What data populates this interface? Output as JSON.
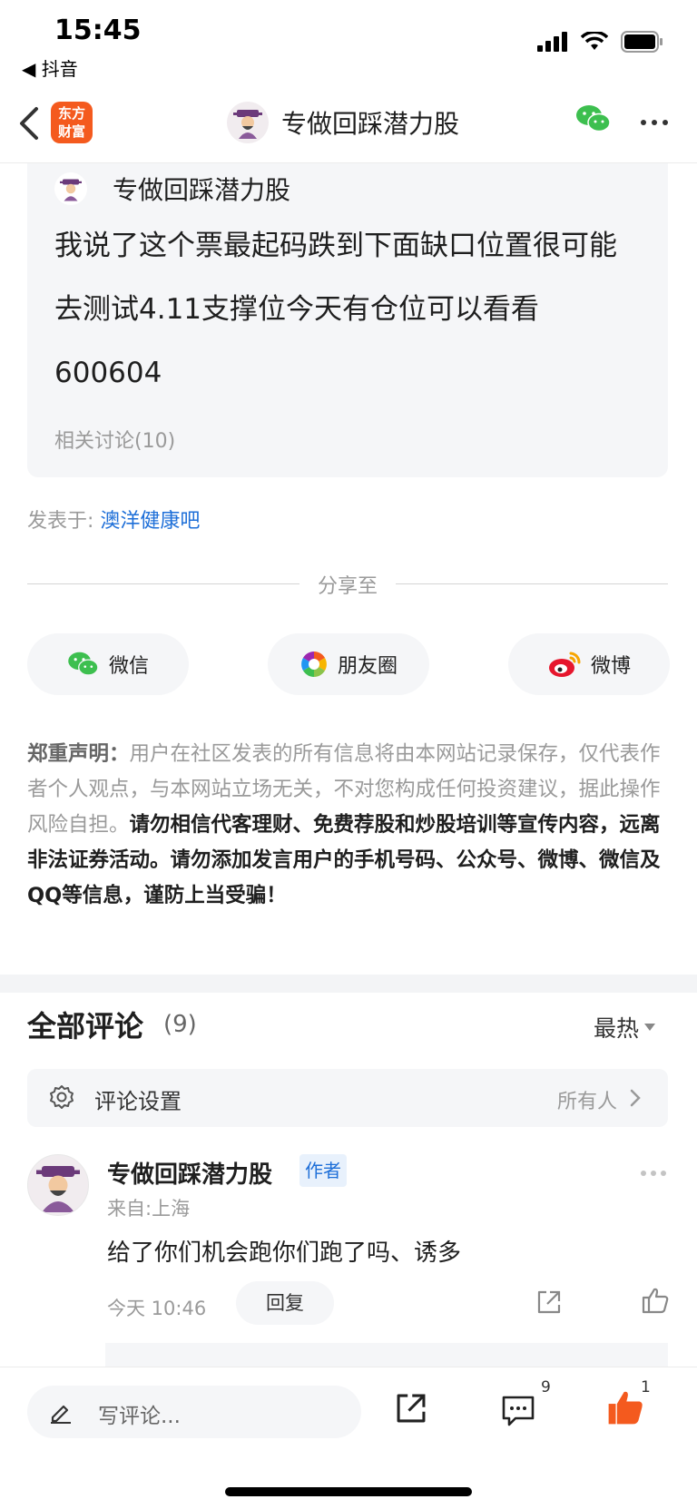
{
  "status_bar": {
    "time": "15:45",
    "back_app": "◀ 抖音"
  },
  "nav": {
    "app_logo_line1": "东方",
    "app_logo_line2": "财富",
    "title": "专做回踩潜力股"
  },
  "post": {
    "author": "专做回踩潜力股",
    "text": "我说了这个票最起码跌到下面缺口位置很可能去测试4.11支撑位今天有仓位可以看看600604",
    "related": "相关讨论(10)",
    "posted_in_label": "发表于:",
    "forum": "澳洋健康吧"
  },
  "share": {
    "label": "分享至",
    "targets": [
      {
        "label": "微信",
        "icon": "wechat-icon"
      },
      {
        "label": "朋友圈",
        "icon": "moments-icon"
      },
      {
        "label": "微博",
        "icon": "weibo-icon"
      }
    ]
  },
  "disclaimer": {
    "heading": "郑重声明：",
    "normal": "用户在社区发表的所有信息将由本网站记录保存，仅代表作者个人观点，与本网站立场无关，不对您构成任何投资建议，据此操作风险自担。",
    "strong": "请勿相信代客理财、免费荐股和炒股培训等宣传内容，远离非法证券活动。请勿添加发言用户的手机号码、公众号、微博、微信及QQ等信息，谨防上当受骗！"
  },
  "comments": {
    "title": "全部评论",
    "count": "(9)",
    "sort": "最热",
    "settings_label": "评论设置",
    "settings_value": "所有人",
    "items": [
      {
        "author": "专做回踩潜力股",
        "badge": "作者",
        "location": "来自:上海",
        "text": "给了你们机会跑你们跑了吗、诱多",
        "time": "今天 10:46",
        "reply_label": "回复"
      }
    ]
  },
  "bottom_bar": {
    "placeholder": "写评论...",
    "comments_count": "9",
    "likes_count": "1"
  },
  "colors": {
    "accent_blue": "#1e6fd8",
    "like_orange": "#f45a1e",
    "wechat_green": "#3dbf4f"
  }
}
